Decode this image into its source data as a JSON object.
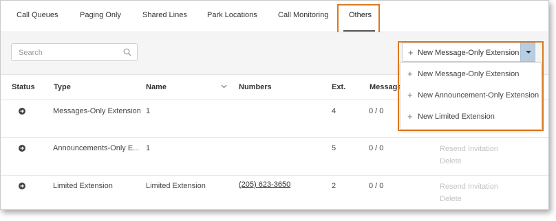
{
  "tabs": [
    {
      "label": "Call Queues"
    },
    {
      "label": "Paging Only"
    },
    {
      "label": "Shared Lines"
    },
    {
      "label": "Park Locations"
    },
    {
      "label": "Call Monitoring"
    },
    {
      "label": "Others"
    }
  ],
  "active_tab": "Others",
  "search": {
    "placeholder": "Search"
  },
  "new_button": {
    "label": "New Message-Only Extension"
  },
  "dropdown": {
    "items": [
      {
        "label": "New Message-Only Extension"
      },
      {
        "label": "New Announcement-Only Extension"
      },
      {
        "label": "New Limited Extension"
      }
    ]
  },
  "table": {
    "headers": {
      "status": "Status",
      "type": "Type",
      "name": "Name",
      "numbers": "Numbers",
      "ext": "Ext.",
      "messages": "Message"
    },
    "rows": [
      {
        "type": "Messages-Only Extension",
        "name": "1",
        "numbers": "",
        "ext": "4",
        "messages": "0 / 0",
        "actions": [
          "",
          ""
        ]
      },
      {
        "type": "Announcements-Only E...",
        "name": "1",
        "numbers": "",
        "ext": "5",
        "messages": "0 / 0",
        "actions": [
          "Resend Invitation",
          "Delete"
        ]
      },
      {
        "type": "Limited Extension",
        "name": "Limited Extension",
        "numbers": "(205) 623-3650",
        "ext": "2",
        "messages": "0 / 0",
        "actions": [
          "Resend Invitation",
          "Delete"
        ]
      }
    ]
  },
  "colors": {
    "highlight": "#d97a1f",
    "caret_button": "#b9cde0",
    "status_icon": "#444444"
  }
}
